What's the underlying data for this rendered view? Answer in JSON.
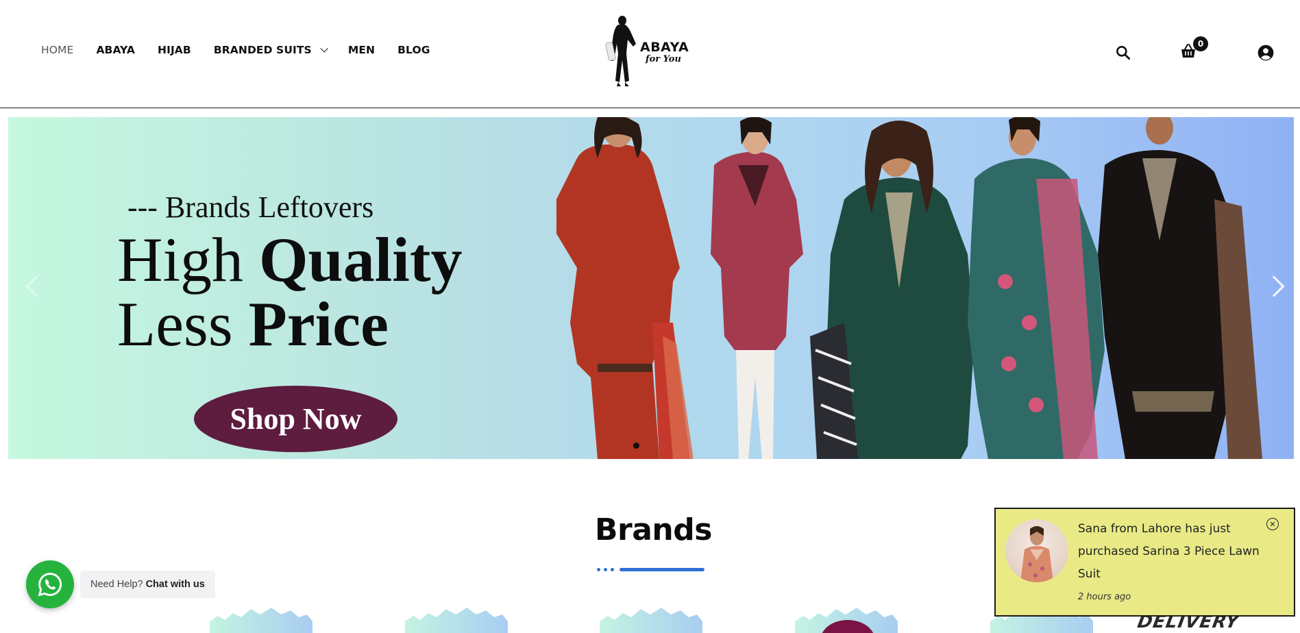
{
  "header": {
    "nav": [
      {
        "label": "HOME",
        "active": true
      },
      {
        "label": "ABAYA"
      },
      {
        "label": "HIJAB"
      },
      {
        "label": "BRANDED SUITS",
        "has_dropdown": true
      },
      {
        "label": "MEN"
      },
      {
        "label": "BLOG"
      }
    ],
    "logo": {
      "line1": "ABAYA",
      "line2": "for You"
    },
    "icons": {
      "search": "search-icon",
      "cart": "basket-icon",
      "user": "user-circle-icon"
    },
    "cart_count": "0"
  },
  "hero": {
    "subtitle": "--- Brands Leftovers",
    "title_line1_a": "High ",
    "title_line1_b": "Quality",
    "title_line2_a": "Less ",
    "title_line2_b": "Price",
    "cta": "Shop Now",
    "colors": {
      "cta_bg": "#5e1c3f",
      "gradient_start": "#c5f8df",
      "gradient_end": "#8fb1f4"
    }
  },
  "brands": {
    "title": "Brands",
    "accent": "#2f6fd6"
  },
  "whatsapp": {
    "prefix": "Need Help?",
    "strong": "Chat with us",
    "color": "#25b33e"
  },
  "notification": {
    "message": "Sana from Lahore has just purchased Sarina 3 Piece Lawn Suit",
    "time": "2 hours ago",
    "bg": "#e9ea86"
  },
  "delivery_banner": {
    "text": "DELIVERY"
  }
}
